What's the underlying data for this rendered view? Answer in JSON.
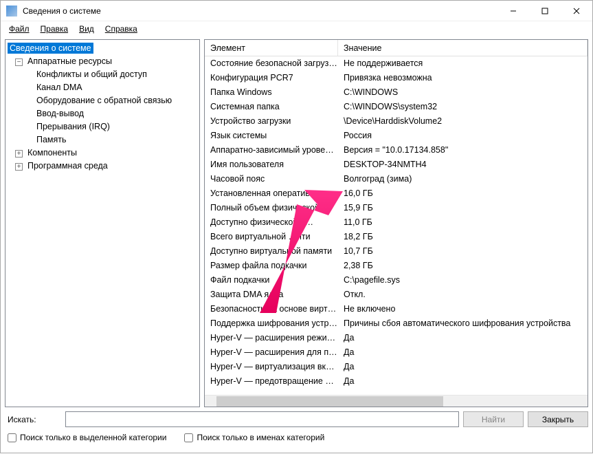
{
  "window": {
    "title": "Сведения о системе"
  },
  "menu": {
    "file": "Файл",
    "edit": "Правка",
    "view": "Вид",
    "help": "Справка"
  },
  "tree": {
    "root": "Сведения о системе",
    "hardware": "Аппаратные ресурсы",
    "hw_conflicts": "Конфликты и общий доступ",
    "hw_dma": "Канал DMA",
    "hw_feedback": "Оборудование с обратной связью",
    "hw_io": "Ввод-вывод",
    "hw_irq": "Прерывания (IRQ)",
    "hw_memory": "Память",
    "components": "Компоненты",
    "softenv": "Программная среда"
  },
  "columns": {
    "element": "Элемент",
    "value": "Значение"
  },
  "rows": [
    {
      "k": "Состояние безопасной загруз…",
      "v": "Не поддерживается"
    },
    {
      "k": "Конфигурация PCR7",
      "v": "Привязка невозможна"
    },
    {
      "k": "Папка Windows",
      "v": "C:\\WINDOWS"
    },
    {
      "k": "Системная папка",
      "v": "C:\\WINDOWS\\system32"
    },
    {
      "k": "Устройство загрузки",
      "v": "\\Device\\HarddiskVolume2"
    },
    {
      "k": "Язык системы",
      "v": "Россия"
    },
    {
      "k": "Аппаратно-зависимый уровен…",
      "v": "Версия = \"10.0.17134.858\""
    },
    {
      "k": "Имя пользователя",
      "v": "DESKTOP-34NMTH4"
    },
    {
      "k": "Часовой пояс",
      "v": "Волгоград (зима)"
    },
    {
      "k": "Установленная оперативная п…",
      "v": "16,0 ГБ"
    },
    {
      "k": "Полный объем физической …",
      "v": "15,9 ГБ"
    },
    {
      "k": "Доступно физической п…",
      "v": "11,0 ГБ"
    },
    {
      "k": "Всего виртуальной …яти",
      "v": "18,2 ГБ"
    },
    {
      "k": "Доступно виртуальной памяти",
      "v": "10,7 ГБ"
    },
    {
      "k": "Размер файла подкачки",
      "v": "2,38 ГБ"
    },
    {
      "k": "Файл подкачки",
      "v": "C:\\pagefile.sys"
    },
    {
      "k": "Защита DMA ядра",
      "v": "Откл."
    },
    {
      "k": "Безопасность на основе вирту…",
      "v": "Не включено"
    },
    {
      "k": "Поддержка шифрования устр…",
      "v": "Причины сбоя автоматического шифрования устройства"
    },
    {
      "k": "Hyper-V — расширения режи…",
      "v": "Да"
    },
    {
      "k": "Hyper-V — расширения для п…",
      "v": "Да"
    },
    {
      "k": "Hyper-V — виртуализация вкл…",
      "v": "Да"
    },
    {
      "k": "Hyper-V — предотвращение в…",
      "v": "Да"
    }
  ],
  "search": {
    "label": "Искать:",
    "find_btn": "Найти",
    "close_btn": "Закрыть",
    "cb_selected": "Поиск только в выделенной категории",
    "cb_names": "Поиск только в именах категорий"
  }
}
